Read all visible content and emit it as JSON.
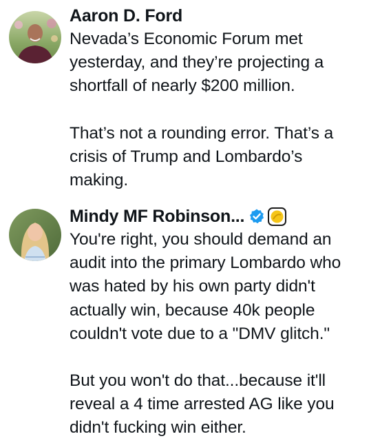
{
  "posts": [
    {
      "author": "Aaron D. Ford",
      "paragraphs": [
        "Nevada’s Economic Forum met\nyesterday, and they’re projecting a\nshortfall of nearly $200 million.",
        "That’s not a rounding error. That’s a\ncrisis of Trump and Lombardo’s\nmaking."
      ]
    },
    {
      "author": "Mindy MF Robinson...",
      "verified": true,
      "verified_color": "#1d9bf0",
      "affiliate_badge_color": "#f5c518",
      "paragraphs": [
        "You're right, you should demand an\naudit into the primary Lombardo who\nwas hated by his own party didn't\nactually win, because 40k people\ncouldn't vote due to a \"DMV glitch.\"",
        "But you won't do that...because it'll\nreveal a 4 time arrested AG like you\ndidn't fucking win either."
      ]
    }
  ]
}
